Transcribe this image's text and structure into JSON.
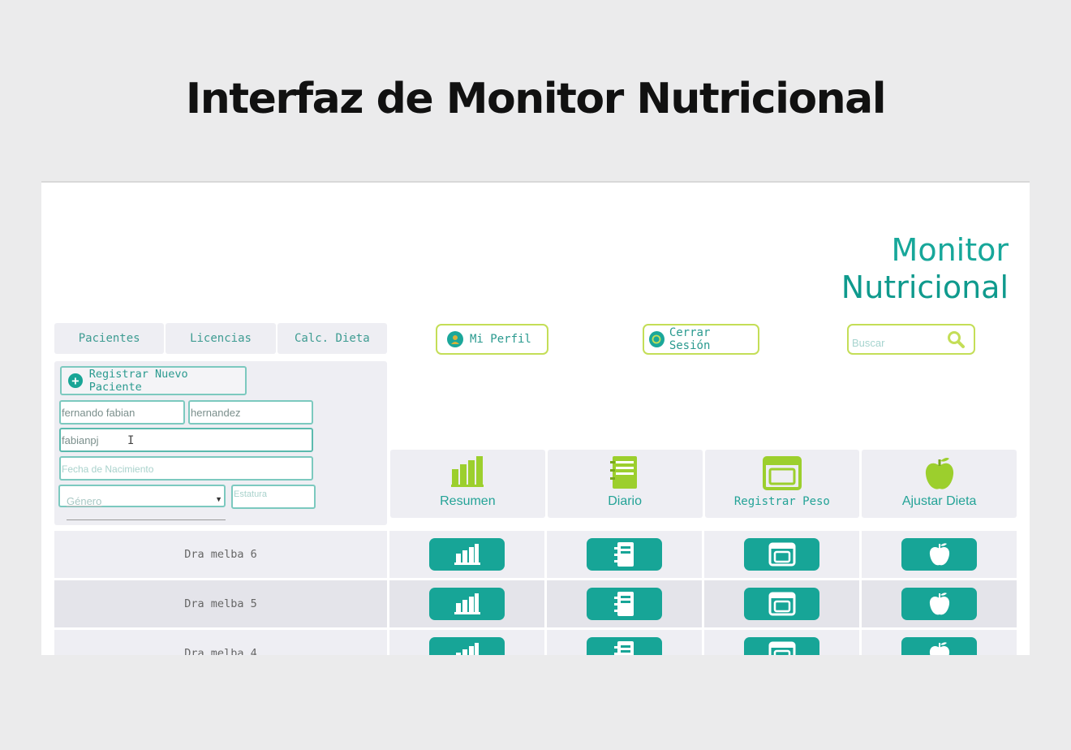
{
  "slide": {
    "title": "Interfaz de Monitor Nutricional"
  },
  "brand": {
    "line1": "Monitor",
    "line2": "Nutricional"
  },
  "nav": {
    "tabs": [
      "Pacientes",
      "Licencias",
      "Calc. Dieta"
    ]
  },
  "header": {
    "profile_label": "Mi Perfil",
    "logout_label": "Cerrar Sesión",
    "search_placeholder": "Buscar"
  },
  "form": {
    "register_label": "Registrar Nuevo Paciente",
    "first_name_value": "fernando fabian",
    "last_name_value": "hernandez",
    "username_value": "fabianpj",
    "birthdate_placeholder": "Fecha de Nacimiento",
    "gender_placeholder": "Género",
    "height_placeholder": "Estatura"
  },
  "features": [
    {
      "label": "Resumen",
      "icon": "bar-chart-icon"
    },
    {
      "label": "Diario",
      "icon": "notebook-icon"
    },
    {
      "label": "Registrar Peso",
      "icon": "scale-icon"
    },
    {
      "label": "Ajustar Dieta",
      "icon": "apple-icon"
    }
  ],
  "patients": [
    "Dra melba 6",
    "Dra melba 5",
    "Dra melba 4"
  ],
  "colors": {
    "teal": "#17a597",
    "lime": "#c4de57",
    "panel": "#eeeef3"
  }
}
